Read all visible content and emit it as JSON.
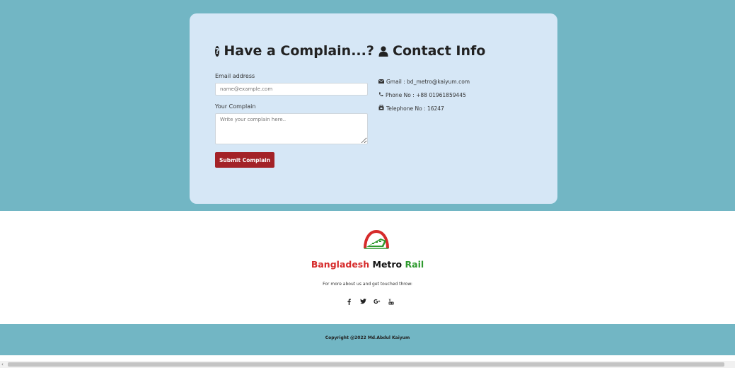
{
  "complaint_form": {
    "heading": "Have a Complain...?",
    "email_label": "Email address",
    "email_placeholder": "name@example.com",
    "complaint_label": "Your Complain",
    "complaint_placeholder": "Write your complain here..",
    "submit_label": "Submit Complain",
    "icon": "question-circle-icon"
  },
  "contact_info": {
    "heading": "Contact Info",
    "icon": "user-icon",
    "items": [
      {
        "icon": "envelope-icon",
        "text": "Gmail : bd_metro@kaiyum.com"
      },
      {
        "icon": "phone-icon",
        "text": "Phone No : +88 01961859445"
      },
      {
        "icon": "telephone-icon",
        "text": "Telephone No : 16247"
      }
    ]
  },
  "footer": {
    "brand_part1": "Bangladesh",
    "brand_part2": "Metro",
    "brand_part3": "Rail",
    "tagline": "For more about us and get touched throw:",
    "socials": [
      {
        "icon": "facebook-icon",
        "glyph": "f"
      },
      {
        "icon": "twitter-icon",
        "glyph": "✓"
      },
      {
        "icon": "google-plus-icon",
        "glyph": "G+"
      },
      {
        "icon": "youtube-icon",
        "glyph": "▶"
      }
    ],
    "copyright": "Copyright  @2022  Md.Abdul  Kaiyum"
  },
  "colors": {
    "band": "#72b6c4",
    "card": "#d6e7f6",
    "submit_button": "#a32227",
    "brand_red": "#d62b2b",
    "brand_green": "#2f9a2f"
  }
}
